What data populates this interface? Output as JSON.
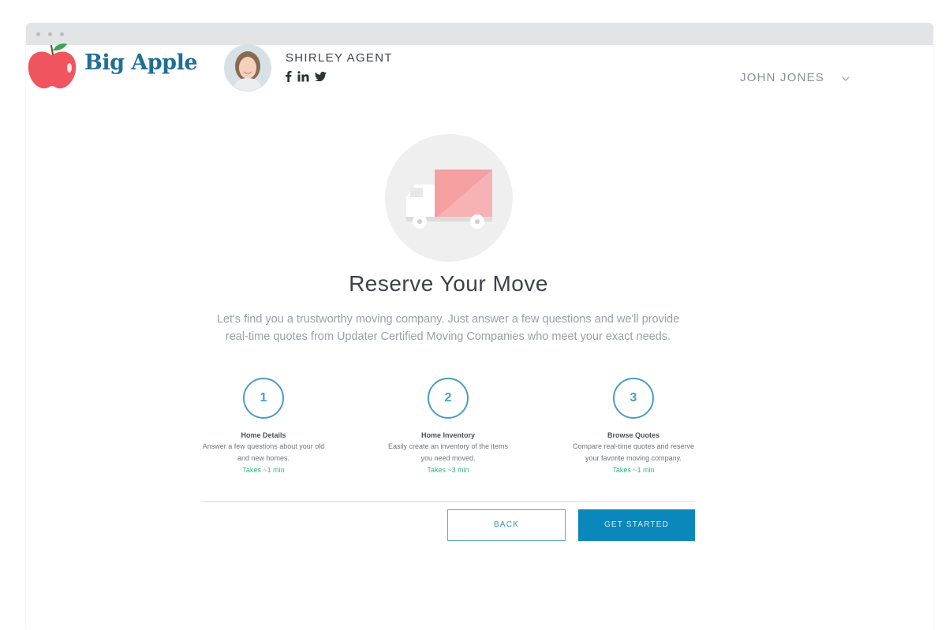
{
  "brand": {
    "name": "Big Apple",
    "apple_color": "#f0555f",
    "leaf_color": "#3aa659",
    "text_color": "#1f6f95"
  },
  "agent": {
    "name": "SHIRLEY AGENT",
    "socials": [
      "facebook-icon",
      "linkedin-icon",
      "twitter-icon"
    ]
  },
  "user_menu": {
    "name": "JOHN JONES",
    "icon": "chevron-down-icon"
  },
  "hero": {
    "icon": "moving-truck-icon",
    "title": "Reserve Your Move",
    "description": "Let's find you a trustworthy moving company. Just answer a few questions and we'll provide real-time quotes from Updater Certified Moving Companies who meet your exact needs."
  },
  "steps": [
    {
      "number": "1",
      "title": "Home Details",
      "description": "Answer a few questions about your old and new homes.",
      "time": "Takes ~1 min"
    },
    {
      "number": "2",
      "title": "Home Inventory",
      "description": "Easily create an inventory of the items you need moved.",
      "time": "Takes ~3 min"
    },
    {
      "number": "3",
      "title": "Browse Quotes",
      "description": "Compare real-time quotes and reserve your favorite moving company.",
      "time": "Takes ~1 min"
    }
  ],
  "actions": {
    "back_label": "BACK",
    "start_label": "GET STARTED"
  },
  "colors": {
    "accent": "#0a88bb",
    "step_ring": "#4a9cc6",
    "time_text": "#32b48e",
    "truck_box": "#f4a0a3"
  }
}
